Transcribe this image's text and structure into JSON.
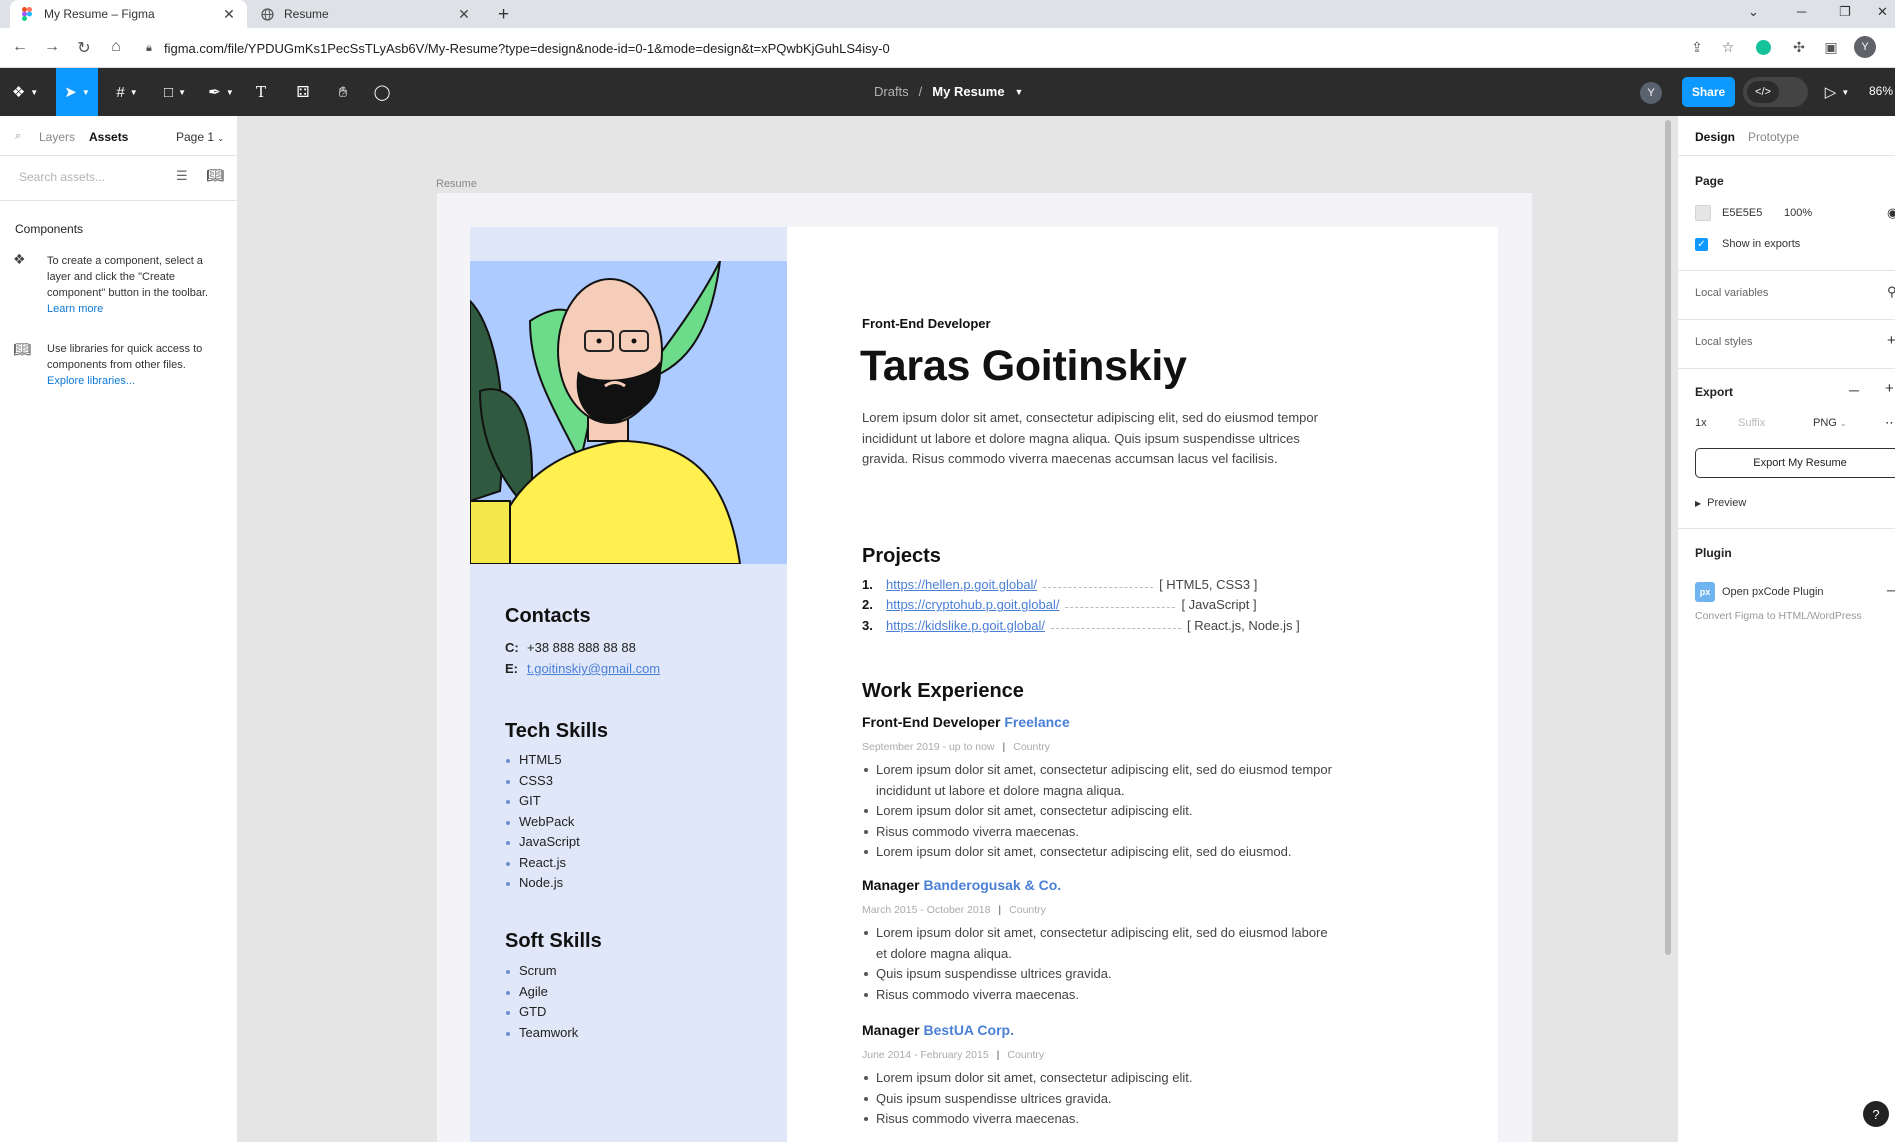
{
  "browser": {
    "tabs": [
      {
        "title": "My Resume – Figma",
        "active": true
      },
      {
        "title": "Resume",
        "active": false
      }
    ],
    "url": "figma.com/file/YPDUGmKs1PecSsTLyAsb6V/My-Resume?type=design&node-id=0-1&mode=design&t=xPQwbKjGuhLS4isy-0",
    "profile_initial": "Y"
  },
  "toolbar": {
    "breadcrumb_parent": "Drafts",
    "breadcrumb_sep": "/",
    "file_name": "My Resume",
    "user_initial": "Y",
    "share_label": "Share",
    "zoom": "86%"
  },
  "left_panel": {
    "tab_layers": "Layers",
    "tab_assets": "Assets",
    "page_selector": "Page 1",
    "search_placeholder": "Search assets...",
    "components_title": "Components",
    "components_help": "To create a component, select a layer and click the \"Create component\" button in the toolbar.",
    "learn_more": "Learn more",
    "libraries_help": "Use libraries for quick access to components from other files.",
    "explore_libraries": "Explore libraries..."
  },
  "canvas": {
    "frame_label": "Resume"
  },
  "resume": {
    "role": "Front-End Developer",
    "name": "Taras Goitinskiy",
    "intro": "Lorem ipsum dolor sit amet, consectetur adipiscing elit, sed do eiusmod tempor incididunt ut labore et dolore magna aliqua. Quis ipsum suspendisse ultrices gravida. Risus commodo viverra maecenas accumsan lacus vel facilisis.",
    "contacts_title": "Contacts",
    "phone_label": "C:",
    "phone": "+38 888 888 88 88",
    "email_label": "E:",
    "email": "t.goitinskiy@gmail.com",
    "tech_title": "Tech Skills",
    "tech_skills": [
      "HTML5",
      "CSS3",
      "GIT",
      "WebPack",
      "JavaScript",
      "React.js",
      "Node.js"
    ],
    "soft_title": "Soft Skills",
    "soft_skills": [
      "Scrum",
      "Agile",
      "GTD",
      "Teamwork"
    ],
    "projects_title": "Projects",
    "projects": [
      {
        "num": "1.",
        "url": "https://hellen.p.goit.global/",
        "tech": "[ HTML5, CSS3 ]"
      },
      {
        "num": "2.",
        "url": "https://cryptohub.p.goit.global/",
        "tech": "[ JavaScript ]"
      },
      {
        "num": "3.",
        "url": "https://kidslike.p.goit.global/",
        "tech": "[ React.js, Node.js ]"
      }
    ],
    "work_title": "Work Experience",
    "jobs": [
      {
        "position": "Front-End Developer",
        "company": "Freelance",
        "period": "September 2019 - up to now",
        "sep": "|",
        "country": "Country",
        "items": [
          "Lorem ipsum dolor sit amet, consectetur adipiscing elit, sed do eiusmod tempor incididunt ut labore et dolore magna aliqua.",
          "Lorem ipsum dolor sit amet, consectetur adipiscing elit.",
          "Risus commodo viverra maecenas.",
          "Lorem ipsum dolor sit amet, consectetur adipiscing elit, sed do eiusmod."
        ]
      },
      {
        "position": "Manager",
        "company": "Banderogusak & Co.",
        "period": "March 2015 - October 2018",
        "sep": "|",
        "country": "Country",
        "items": [
          "Lorem ipsum dolor sit amet, consectetur adipiscing elit, sed do eiusmod labore et dolore magna aliqua.",
          "Quis ipsum suspendisse ultrices gravida.",
          "Risus commodo viverra maecenas."
        ]
      },
      {
        "position": "Manager",
        "company": "BestUA Corp.",
        "period": "June 2014 - February 2015",
        "sep": "|",
        "country": "Country",
        "items": [
          "Lorem ipsum dolor sit amet, consectetur adipiscing elit.",
          "Quis ipsum suspendisse ultrices gravida.",
          "Risus commodo viverra maecenas."
        ]
      }
    ]
  },
  "right_panel": {
    "tab_design": "Design",
    "tab_prototype": "Prototype",
    "page_title": "Page",
    "page_color": "E5E5E5",
    "page_opacity": "100%",
    "show_in_exports": "Show in exports",
    "local_variables": "Local variables",
    "local_styles": "Local styles",
    "export_title": "Export",
    "export_scale": "1x",
    "export_suffix_placeholder": "Suffix",
    "export_format": "PNG",
    "export_button": "Export My Resume",
    "preview": "Preview",
    "plugin_title": "Plugin",
    "plugin_icon_text": "px",
    "plugin_name": "Open pxCode Plugin",
    "plugin_desc": "Convert Figma to HTML/WordPress"
  },
  "colors": {
    "figma_blue": "#0d99ff",
    "toolbar_bg": "#2c2c2c",
    "resume_sidebar": "#dfe7f9",
    "resume_link": "#4a7fd6"
  }
}
